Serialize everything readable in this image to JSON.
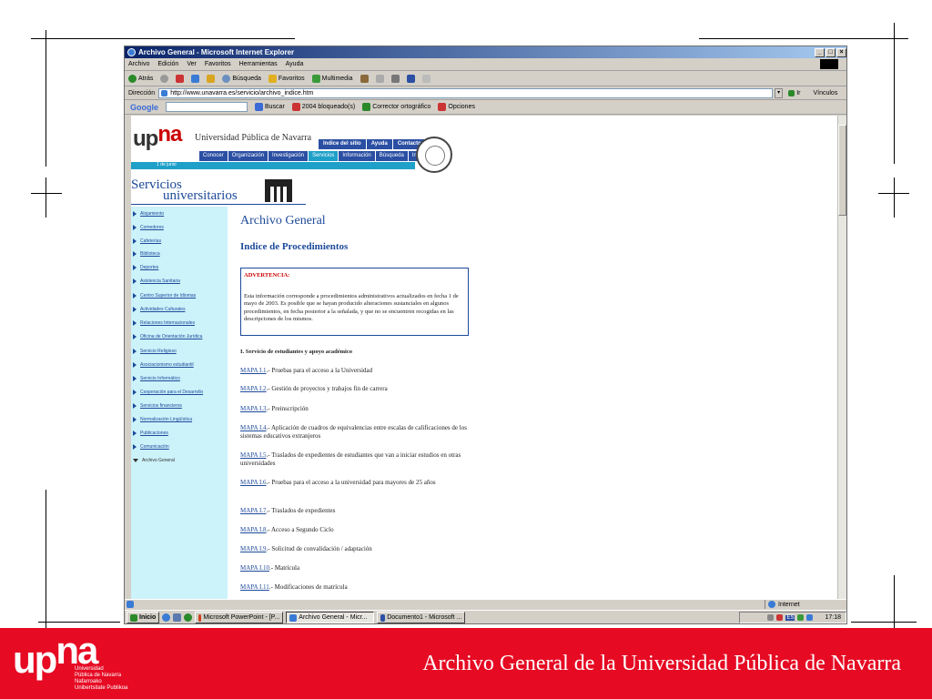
{
  "window": {
    "title": "Archivo General - Microsoft Internet Explorer",
    "controls": [
      "_",
      "□",
      "×"
    ]
  },
  "menu": [
    "Archivo",
    "Edición",
    "Ver",
    "Favoritos",
    "Herramientas",
    "Ayuda"
  ],
  "toolbar": {
    "back": "Atrás",
    "search": "Búsqueda",
    "favorites": "Favoritos",
    "multimedia": "Multimedia"
  },
  "address": {
    "label": "Dirección",
    "url": "http://www.unavarra.es/servicio/archivo_indice.htm",
    "go": "Ir",
    "links": "Vínculos"
  },
  "google_bar": {
    "logo": "Google",
    "search_btn": "Buscar",
    "blocked": "2004 bloqueado(s)",
    "spell": "Corrector ortográfico",
    "options": "Opciones"
  },
  "page": {
    "logo_up": "up",
    "logo_na": "na",
    "university": "Universidad Pública de Navarra",
    "top_nav": [
      "Indice del sitio",
      "Ayuda",
      "Contacto"
    ],
    "main_nav": [
      "Conocer",
      "Organización",
      "Investigación",
      "Servicios",
      "Información",
      "Búsqueda",
      "Internet"
    ],
    "subbar": "1 de junio",
    "services_title_1": "Servicios",
    "services_title_2": "universitarios",
    "sidebar": [
      "Alojamiento",
      "Comedores",
      "Cafeterías",
      "Biblioteca",
      "Deportes",
      "Asistencia Sanitaria",
      "Centro Superior de Idiomas",
      "Actividades Culturales",
      "Relaciones Internacionales",
      "Oficina de Orientación Jurídica",
      "Servicio Religioso",
      "Asociacionismo estudiantil",
      "Servicio Informático",
      "Cooperación para el Desarrollo",
      "Servicios financieros",
      "Normalización Lingüística",
      "Publicaciones",
      "Comunicación",
      "Archivo General"
    ],
    "main_title": "Archivo General",
    "subtitle": "Indice de Procedimientos",
    "warning_head": "ADVERTENCIA:",
    "warning_text": "Esta información corresponde a procedimientos administrativos actualizados en fecha 1 de mayo de 2003. Es posible que se hayan producido alteraciones sustanciales en algunos procedimientos, en fecha posterior a la señalada, y que no se encuentren recogidas en las descripciones de los mismos.",
    "section": "I. Servicio de estudiantes y apoyo académico",
    "mapas": [
      {
        "link": "MAPA I.1",
        "text": ".- Pruebas para el acceso a la Universidad"
      },
      {
        "link": "MAPA I.2",
        "text": ".- Gestión de proyectos y trabajos fin de carrera"
      },
      {
        "link": "MAPA I.3",
        "text": ".- Preinscripción"
      },
      {
        "link": "MAPA I.4",
        "text": ".- Aplicación de cuadros de equivalencias entre escalas de calificaciones de los sistemas educativos extranjeros"
      },
      {
        "link": "MAPA I.5",
        "text": ".- Traslados de expedientes de estudiantes que van a iniciar estudios en otras universidades"
      },
      {
        "link": "MAPA I.6",
        "text": ".- Pruebas para el acceso a la universidad para mayores de 25 años"
      },
      {
        "link": "MAPA I.7",
        "text": ".- Traslados de expedientes"
      },
      {
        "link": "MAPA I.8",
        "text": ".- Acceso a Segundo Ciclo"
      },
      {
        "link": "MAPA I.9",
        "text": ".- Solicitud de convalidación / adaptación"
      },
      {
        "link": "MAPA I.10",
        "text": ".- Matrícula"
      },
      {
        "link": "MAPA I.11",
        "text": ".- Modificaciones de matrícula"
      }
    ]
  },
  "status": {
    "zone": "Internet"
  },
  "taskbar": {
    "start": "Inicio",
    "tasks": [
      "Microsoft PowerPoint - [P...",
      "Archivo General - Micr...",
      "Documento1 - Microsoft ..."
    ],
    "lang": "ES",
    "clock": "17:18"
  },
  "footer": {
    "logo_up": "up",
    "logo_na": "na",
    "sub_lines": [
      "Universidad",
      "Pública de Navarra",
      "Nafarroako",
      "Unibertsitate Publikoa"
    ],
    "title": "Archivo General de la Universidad Pública de Navarra"
  }
}
